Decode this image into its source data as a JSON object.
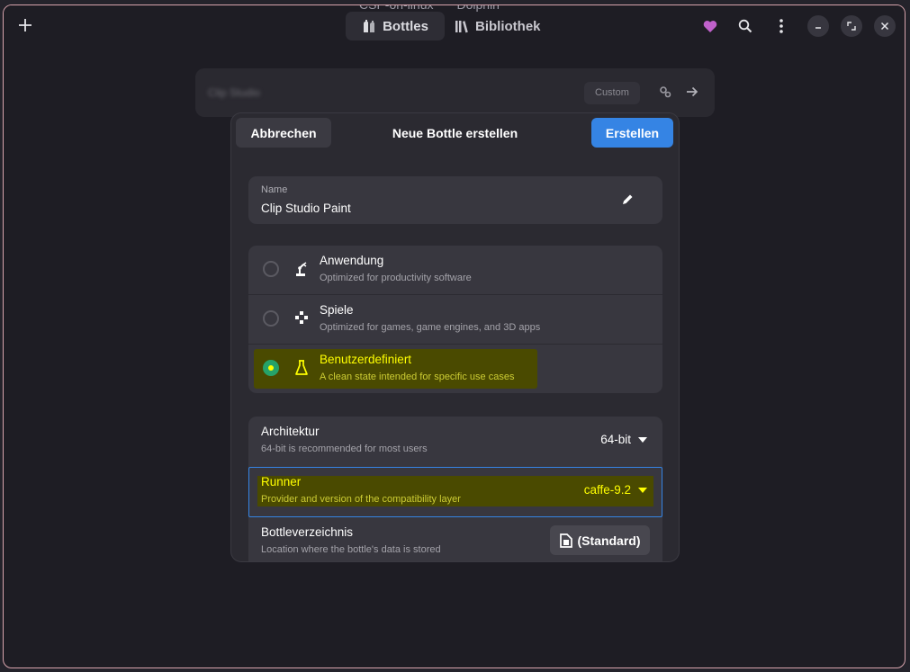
{
  "header": {
    "background_title_left": "CSP-on-linux",
    "background_title_right": "Dolphin",
    "views": [
      {
        "label": "Bottles",
        "icon": "bottles-icon"
      },
      {
        "label": "Bibliothek",
        "icon": "library-icon"
      }
    ],
    "icons": [
      "plus-icon",
      "heart-icon",
      "search-icon",
      "menu-icon",
      "minimize-icon",
      "maximize-icon",
      "close-icon"
    ]
  },
  "background": {
    "custom_label": "Custom"
  },
  "dialog": {
    "cancel_label": "Abbrechen",
    "title": "Neue Bottle erstellen",
    "create_label": "Erstellen",
    "name": {
      "label": "Name",
      "value": "Clip Studio Paint"
    },
    "environments": [
      {
        "title": "Anwendung",
        "subtitle": "Optimized for productivity software",
        "selected": false
      },
      {
        "title": "Spiele",
        "subtitle": "Optimized for games, game engines, and 3D apps",
        "selected": false
      },
      {
        "title": "Benutzerdefiniert",
        "subtitle": "A clean state intended for specific use cases",
        "selected": true
      }
    ],
    "architecture": {
      "title": "Architektur",
      "subtitle": "64-bit is recommended for most users",
      "value": "64-bit"
    },
    "runner": {
      "title": "Runner",
      "subtitle": "Provider and version of the compatibility layer",
      "value": "caffe-9.2"
    },
    "directory": {
      "title": "Bottleverzeichnis",
      "subtitle": "Location where the bottle's data is stored",
      "button_label": "(Standard)"
    }
  },
  "colors": {
    "accent": "#3584e4",
    "highlight": "#ffff00",
    "heart": "#c061cb"
  }
}
